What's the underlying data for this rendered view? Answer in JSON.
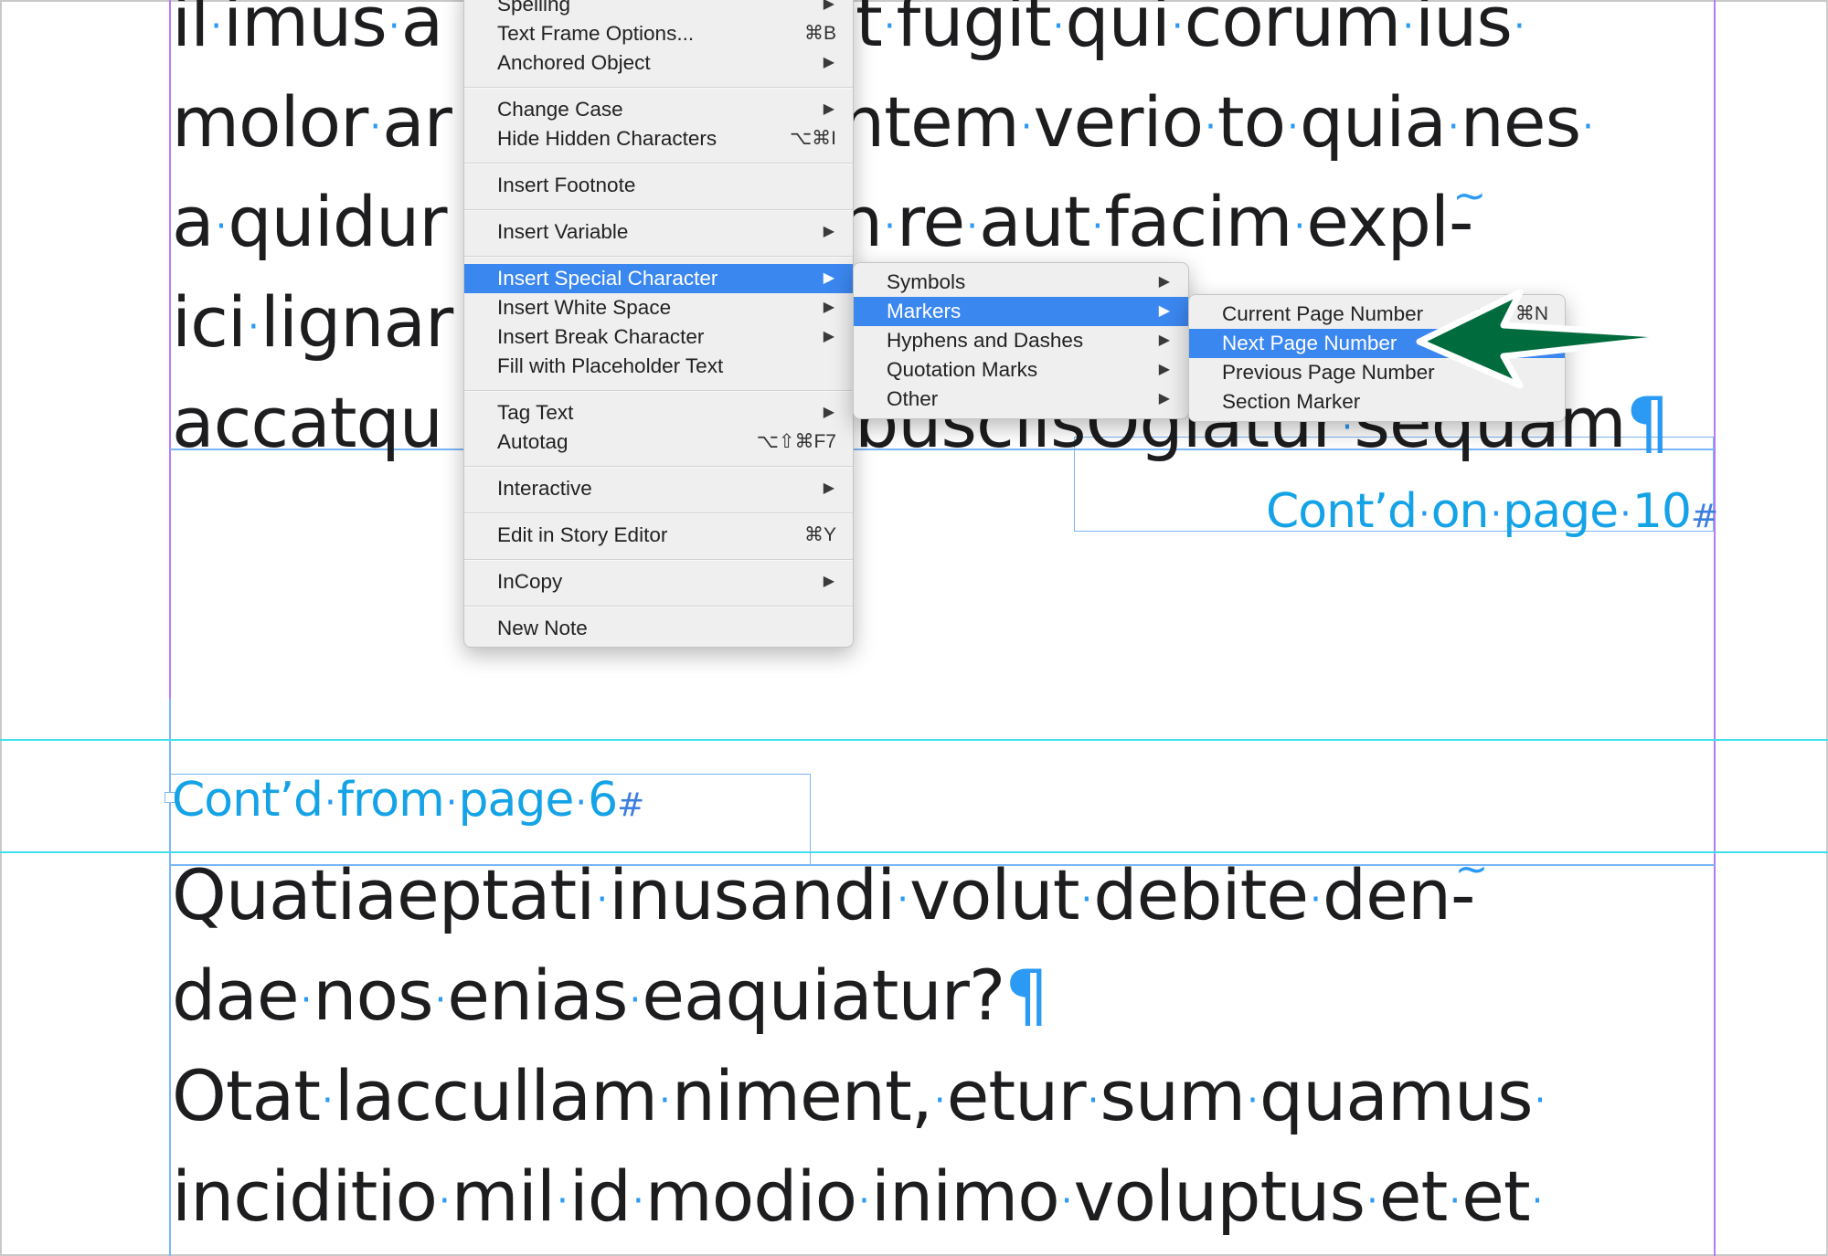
{
  "document": {
    "top_frame_lines": [
      [
        "il",
        "imus",
        "a",
        "t",
        "fugit",
        "qui",
        "corum",
        "ius"
      ],
      [
        "molor",
        "ar",
        "ntem",
        "verio",
        "to",
        "quia",
        "nes"
      ],
      [
        "a",
        "quidur",
        "n",
        "re",
        "aut",
        "facim",
        "expl-"
      ],
      [
        "ici",
        "lignar"
      ],
      [
        "accatqu",
        "busciisOgiatur",
        "sequam"
      ]
    ],
    "top_line_texts": {
      "l1_left": "il·imus·a",
      "l1_right": "t·fugit·qui·corum·ius·",
      "l2_left": "molor·ar",
      "l2_right": "ntem·verio·to·quia·nes·",
      "l3_left": "a·quidur",
      "l3_right": "n·re·aut·facim·expl-",
      "l4_left": "ici·lignar",
      "l5_left": "accatqu",
      "l5_right": "busciisOgiatur·sequam"
    },
    "jump_line_next": "Cont’d·on·page·10",
    "jump_line_prev": "Cont’d·from·page·6",
    "hash_marker": "#",
    "pilcrow": "¶",
    "discretionary_hyphen_marker": "~",
    "bottom_lines": [
      "Quatiaeptati·inusandi·volut·debite·den-",
      "dae·nos·enias·eaquiatur?",
      "Otat·laccullam·niment,·etur·sum·quamus·",
      "inciditio·mil·id·modio·inimo·voluptus·et·et·"
    ]
  },
  "context_menu": {
    "items": [
      {
        "label": "Spelling",
        "submenu": true
      },
      {
        "label": "Text Frame Options...",
        "shortcut": "⌘B"
      },
      {
        "label": "Anchored Object",
        "submenu": true
      },
      {
        "separator": true
      },
      {
        "label": "Change Case",
        "submenu": true
      },
      {
        "label": "Hide Hidden Characters",
        "shortcut": "⌥⌘I"
      },
      {
        "separator": true
      },
      {
        "label": "Insert Footnote"
      },
      {
        "separator": true
      },
      {
        "label": "Insert Variable",
        "submenu": true
      },
      {
        "separator": true
      },
      {
        "label": "Insert Special Character",
        "submenu": true,
        "highlighted": true
      },
      {
        "label": "Insert White Space",
        "submenu": true
      },
      {
        "label": "Insert Break Character",
        "submenu": true
      },
      {
        "label": "Fill with Placeholder Text"
      },
      {
        "separator": true
      },
      {
        "label": "Tag Text",
        "submenu": true
      },
      {
        "label": "Autotag",
        "shortcut": "⌥⇧⌘F7"
      },
      {
        "separator": true
      },
      {
        "label": "Interactive",
        "submenu": true
      },
      {
        "separator": true
      },
      {
        "label": "Edit in Story Editor",
        "shortcut": "⌘Y"
      },
      {
        "separator": true
      },
      {
        "label": "InCopy",
        "submenu": true
      },
      {
        "separator": true
      },
      {
        "label": "New Note"
      }
    ]
  },
  "special_character_submenu": {
    "items": [
      {
        "label": "Symbols",
        "submenu": true
      },
      {
        "label": "Markers",
        "submenu": true,
        "highlighted": true
      },
      {
        "label": "Hyphens and Dashes",
        "submenu": true
      },
      {
        "label": "Quotation Marks",
        "submenu": true
      },
      {
        "label": "Other",
        "submenu": true
      }
    ]
  },
  "markers_submenu": {
    "items": [
      {
        "label": "Current Page Number",
        "shortcut": "⌥⇧⌘N"
      },
      {
        "label": "Next Page Number",
        "highlighted": true
      },
      {
        "label": "Previous Page Number"
      },
      {
        "label": "Section Marker"
      }
    ]
  },
  "annotation": {
    "arrow_color": "#006b3c",
    "points_to": "Next Page Number"
  },
  "colors": {
    "menu_highlight": "#3b87f0",
    "guide_cyan": "#3fe0ee",
    "margin_purple": "#b57cf2",
    "frame_blue": "#7ab6f5",
    "hidden_char_blue": "#2a9af5",
    "jump_text_blue": "#14a3e6"
  },
  "glyphs": {
    "submenu_arrow": "▶"
  }
}
